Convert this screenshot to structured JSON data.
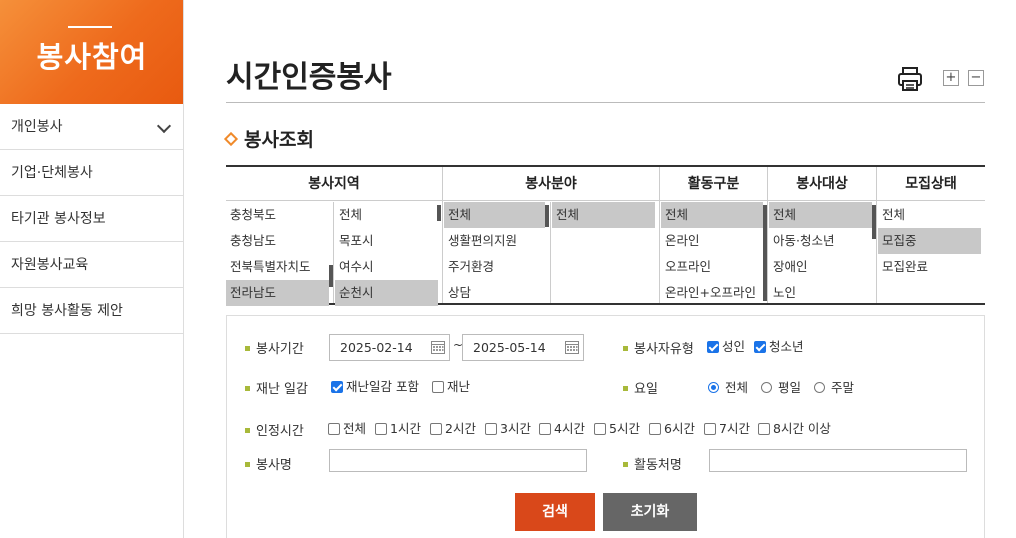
{
  "sidebar": {
    "title": "봉사참여",
    "items": [
      {
        "label": "개인봉사"
      },
      {
        "label": "기업·단체봉사"
      },
      {
        "label": "타기관 봉사정보"
      },
      {
        "label": "자원봉사교육"
      },
      {
        "label": "희망 봉사활동 제안"
      }
    ]
  },
  "page": {
    "title": "시간인증봉사",
    "zoom_in": "+",
    "zoom_out": "−",
    "section_title": "봉사조회"
  },
  "filters": {
    "region": {
      "header": "봉사지역",
      "col1": [
        {
          "label": "충청북도",
          "selected": false
        },
        {
          "label": "충청남도",
          "selected": false
        },
        {
          "label": "전북특별자치도",
          "selected": false
        },
        {
          "label": "전라남도",
          "selected": true
        }
      ],
      "col2": [
        {
          "label": "전체",
          "selected": false
        },
        {
          "label": "목포시",
          "selected": false
        },
        {
          "label": "여수시",
          "selected": false
        },
        {
          "label": "순천시",
          "selected": true
        }
      ]
    },
    "field": {
      "header": "봉사분야",
      "col1": [
        {
          "label": "전체",
          "selected": true
        },
        {
          "label": "생활편의지원",
          "selected": false
        },
        {
          "label": "주거환경",
          "selected": false
        },
        {
          "label": "상담",
          "selected": false
        }
      ],
      "col2": [
        {
          "label": "전체",
          "selected": true
        }
      ]
    },
    "activity": {
      "header": "활동구분",
      "items": [
        {
          "label": "전체",
          "selected": true
        },
        {
          "label": "온라인",
          "selected": false
        },
        {
          "label": "오프라인",
          "selected": false
        },
        {
          "label": "온라인+오프라인",
          "selected": false
        }
      ]
    },
    "target": {
      "header": "봉사대상",
      "items": [
        {
          "label": "전체",
          "selected": true
        },
        {
          "label": "아동·청소년",
          "selected": false
        },
        {
          "label": "장애인",
          "selected": false
        },
        {
          "label": "노인",
          "selected": false
        }
      ]
    },
    "status": {
      "header": "모집상태",
      "items": [
        {
          "label": "전체",
          "selected": false
        },
        {
          "label": "모집중",
          "selected": true
        },
        {
          "label": "모집완료",
          "selected": false
        }
      ]
    }
  },
  "form": {
    "period_label": "봉사기간",
    "date_from": "2025-02-14",
    "date_to": "2025-05-14",
    "tilde": "~",
    "type_label": "봉사자유형",
    "type_adult": "성인",
    "type_youth": "청소년",
    "disaster_label": "재난 일감",
    "disaster_include": "재난일감 포함",
    "disaster_only": "재난",
    "day_label": "요일",
    "day_all": "전체",
    "day_weekday": "평일",
    "day_weekend": "주말",
    "hours_label": "인정시간",
    "hours": [
      "전체",
      "1시간",
      "2시간",
      "3시간",
      "4시간",
      "5시간",
      "6시간",
      "7시간",
      "8시간 이상"
    ],
    "name_label": "봉사명",
    "place_label": "활동처명",
    "search_button": "검색",
    "reset_button": "초기화"
  }
}
